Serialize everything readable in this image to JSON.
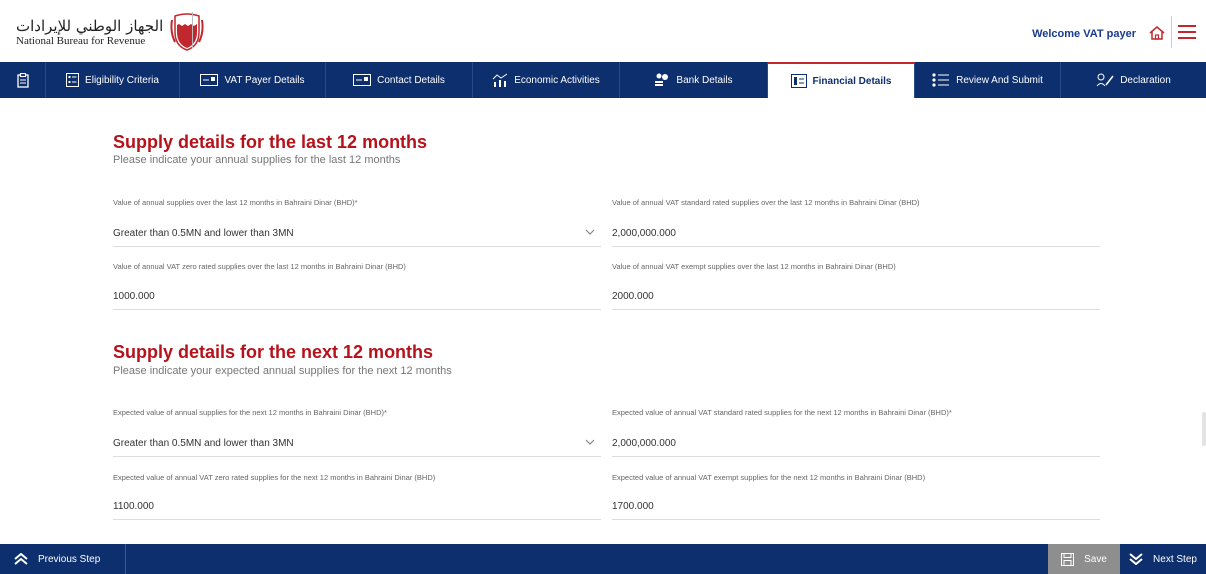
{
  "header": {
    "logo_arabic": "الجهاز الوطني للإيرادات",
    "logo_english": "National Bureau for Revenue",
    "welcome": "Welcome VAT payer"
  },
  "tabs": [
    {
      "label": "Eligibility Criteria",
      "icon": "checklist-icon"
    },
    {
      "label": "VAT Payer Details",
      "icon": "id-card-icon"
    },
    {
      "label": "Contact Details",
      "icon": "contact-card-icon"
    },
    {
      "label": "Economic Activities",
      "icon": "activities-icon"
    },
    {
      "label": "Bank Details",
      "icon": "bank-icon"
    },
    {
      "label": "Financial Details",
      "icon": "financial-icon",
      "active": true
    },
    {
      "label": "Review And Submit",
      "icon": "list-icon"
    },
    {
      "label": "Declaration",
      "icon": "signature-icon"
    }
  ],
  "last12": {
    "title": "Supply details for the last 12 months",
    "subtitle": "Please indicate your annual supplies for the last 12 months",
    "annual_label": "Value of annual supplies over the last 12 months in Bahraini Dinar (BHD)*",
    "annual_value": "Greater than 0.5MN and lower than 3MN",
    "standard_label": "Value of annual VAT standard rated supplies over the last 12 months in Bahraini Dinar (BHD)",
    "standard_value": "2,000,000.000",
    "zero_label": "Value of annual VAT zero rated supplies over the last 12 months in Bahraini Dinar (BHD)",
    "zero_value": "1000.000",
    "exempt_label": "Value of annual VAT exempt supplies over the last 12 months in Bahraini Dinar (BHD)",
    "exempt_value": "2000.000"
  },
  "next12": {
    "title": "Supply details for the next 12 months",
    "subtitle": "Please indicate your expected annual supplies for the next 12 months",
    "annual_label": "Expected value of annual supplies for the next 12 months in Bahraini Dinar (BHD)*",
    "annual_value": "Greater than 0.5MN and lower than 3MN",
    "standard_label": "Expected value of annual VAT standard rated supplies for the next 12 months in Bahraini Dinar (BHD)*",
    "standard_value": "2,000,000.000",
    "zero_label": "Expected value of annual VAT zero rated supplies for the next 12 months in Bahraini Dinar (BHD)",
    "zero_value": "1100.000",
    "exempt_label": "Expected value of annual VAT exempt supplies for the next 12 months in Bahraini Dinar (BHD)",
    "exempt_value": "1700.000"
  },
  "footer": {
    "previous": "Previous Step",
    "save": "Save",
    "next": "Next Step"
  },
  "colors": {
    "navy": "#0d2f6e",
    "accent_red": "#b5121b",
    "save_grey": "#8e8e8e"
  }
}
